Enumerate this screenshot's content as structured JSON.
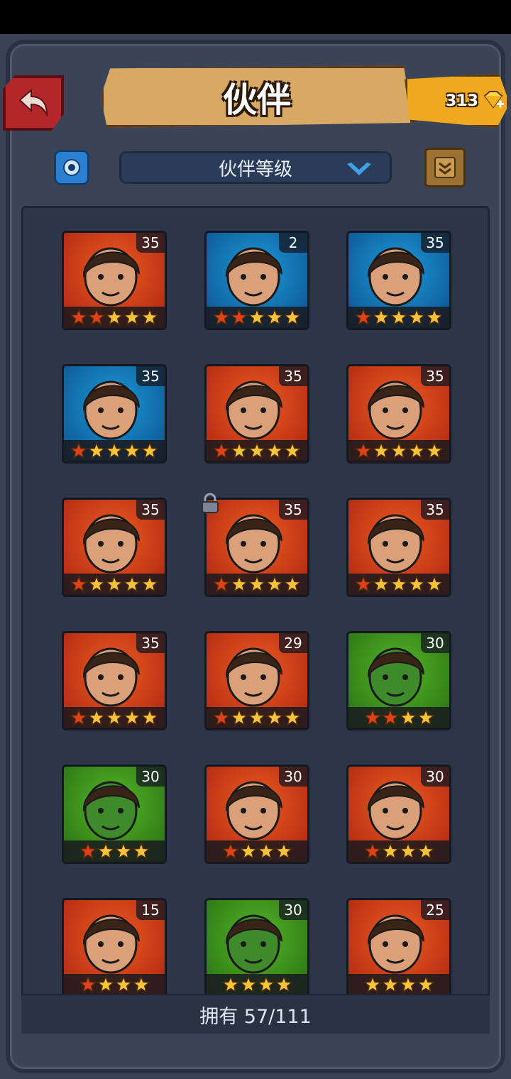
{
  "header": {
    "title": "伙伴",
    "gems": "313",
    "sort_label": "伙伴等级"
  },
  "colors": {
    "frame": "#3b4456",
    "title_banner": "#d8a964",
    "gem_counter": "#f0a81e",
    "back_button": "#b3262a",
    "card_red": "#ee5b22",
    "card_blue": "#1c9ad8",
    "card_green": "#55b726"
  },
  "icons": {
    "back": "back-arrow-icon",
    "gem": "diamond-plus-icon",
    "settings": "settings-gear-icon",
    "dropdown": "chevron-down-icon",
    "scroll": "scroll-icon",
    "lock": "lock-icon"
  },
  "partners": [
    {
      "level": "35",
      "stars": 5,
      "red_stars": 2,
      "bg": "red"
    },
    {
      "level": "2",
      "stars": 5,
      "red_stars": 2,
      "bg": "blue"
    },
    {
      "level": "35",
      "stars": 5,
      "red_stars": 1,
      "bg": "blue"
    },
    {
      "level": "35",
      "stars": 5,
      "red_stars": 1,
      "bg": "blue"
    },
    {
      "level": "35",
      "stars": 5,
      "red_stars": 1,
      "bg": "red"
    },
    {
      "level": "35",
      "stars": 5,
      "red_stars": 1,
      "bg": "red"
    },
    {
      "level": "35",
      "stars": 5,
      "red_stars": 1,
      "bg": "red"
    },
    {
      "level": "35",
      "stars": 5,
      "red_stars": 1,
      "bg": "red",
      "locked": true
    },
    {
      "level": "35",
      "stars": 5,
      "red_stars": 1,
      "bg": "red"
    },
    {
      "level": "35",
      "stars": 5,
      "red_stars": 1,
      "bg": "red"
    },
    {
      "level": "29",
      "stars": 5,
      "red_stars": 1,
      "bg": "red"
    },
    {
      "level": "30",
      "stars": 4,
      "red_stars": 2,
      "bg": "green"
    },
    {
      "level": "30",
      "stars": 4,
      "red_stars": 1,
      "bg": "green"
    },
    {
      "level": "30",
      "stars": 4,
      "red_stars": 1,
      "bg": "red"
    },
    {
      "level": "30",
      "stars": 4,
      "red_stars": 1,
      "bg": "red"
    },
    {
      "level": "15",
      "stars": 4,
      "red_stars": 1,
      "bg": "red"
    },
    {
      "level": "30",
      "stars": 4,
      "red_stars": 0,
      "bg": "green"
    },
    {
      "level": "25",
      "stars": 4,
      "red_stars": 0,
      "bg": "red"
    }
  ],
  "footer": {
    "owned_text": "拥有 57/111"
  }
}
